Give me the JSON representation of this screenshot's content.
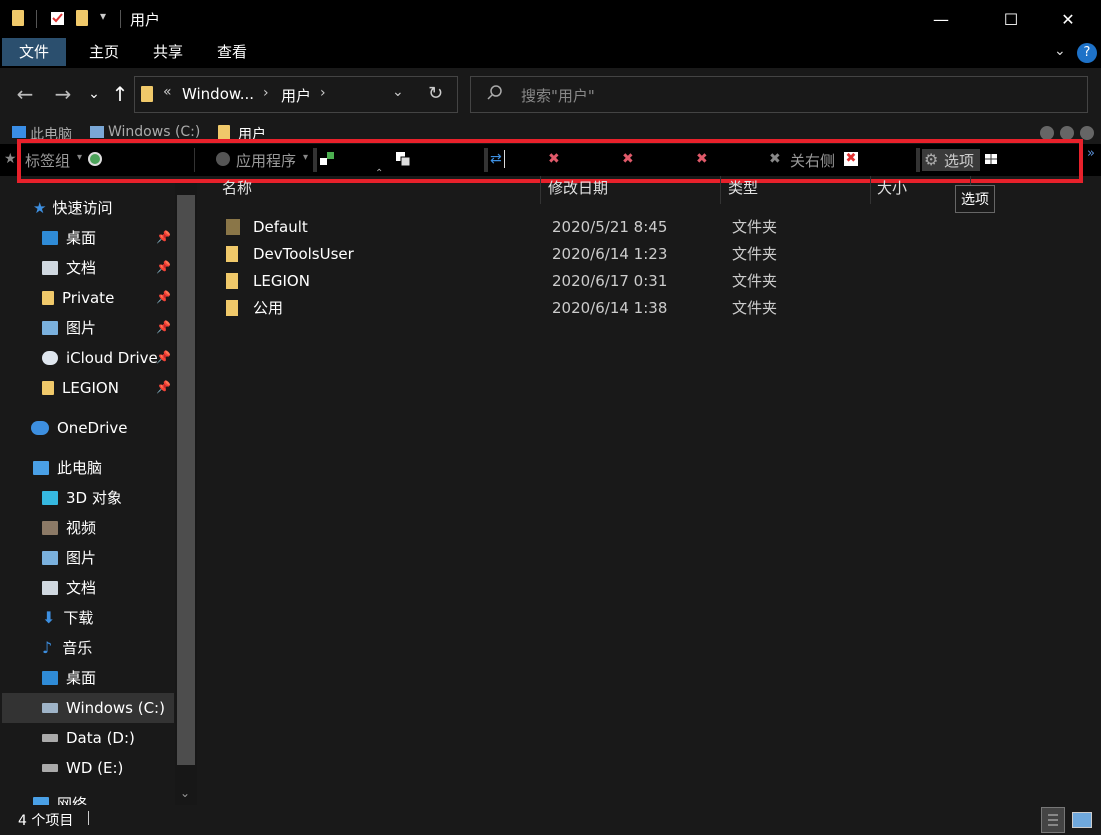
{
  "window": {
    "title": "用户",
    "minimize": "—",
    "maximize": "☐",
    "close": "✕"
  },
  "ribbon": {
    "tabs": [
      "文件",
      "主页",
      "共享",
      "查看"
    ],
    "help": "?"
  },
  "address": {
    "crumb_prefix": "«",
    "crumbs": [
      "Window...",
      "用户"
    ],
    "search_placeholder": "搜索\"用户\""
  },
  "tabs_row": {
    "items": [
      "此电脑",
      "Windows (C:)",
      "用户"
    ]
  },
  "toolbar": {
    "tab_group": "标签组",
    "apps": "应用程序",
    "close_right": "关右侧",
    "options": "选项",
    "tooltip": "选项",
    "overflow": "»"
  },
  "columns": {
    "name": "名称",
    "date": "修改日期",
    "type": "类型",
    "size": "大小"
  },
  "sidebar": {
    "quick_access": "快速访问",
    "quick_items": [
      "桌面",
      "文档",
      "Private",
      "图片",
      "iCloud Drive",
      "LEGION"
    ],
    "onedrive": "OneDrive",
    "this_pc": "此电脑",
    "pc_items": [
      "3D 对象",
      "视频",
      "图片",
      "文档",
      "下载",
      "音乐",
      "桌面",
      "Windows (C:)",
      "Data (D:)",
      "WD (E:)"
    ],
    "network": "网络"
  },
  "files": [
    {
      "name": "Default",
      "date": "2020/5/21 8:45",
      "type": "文件夹"
    },
    {
      "name": "DevToolsUser",
      "date": "2020/6/14 1:23",
      "type": "文件夹"
    },
    {
      "name": "LEGION",
      "date": "2020/6/17 0:31",
      "type": "文件夹"
    },
    {
      "name": "公用",
      "date": "2020/6/14 1:38",
      "type": "文件夹"
    }
  ],
  "status": {
    "count": "4 个项目"
  },
  "colors": {
    "accent_tab": "#2b4f6e",
    "highlight_box": "#e8212b",
    "folder": "#f0c96a"
  }
}
